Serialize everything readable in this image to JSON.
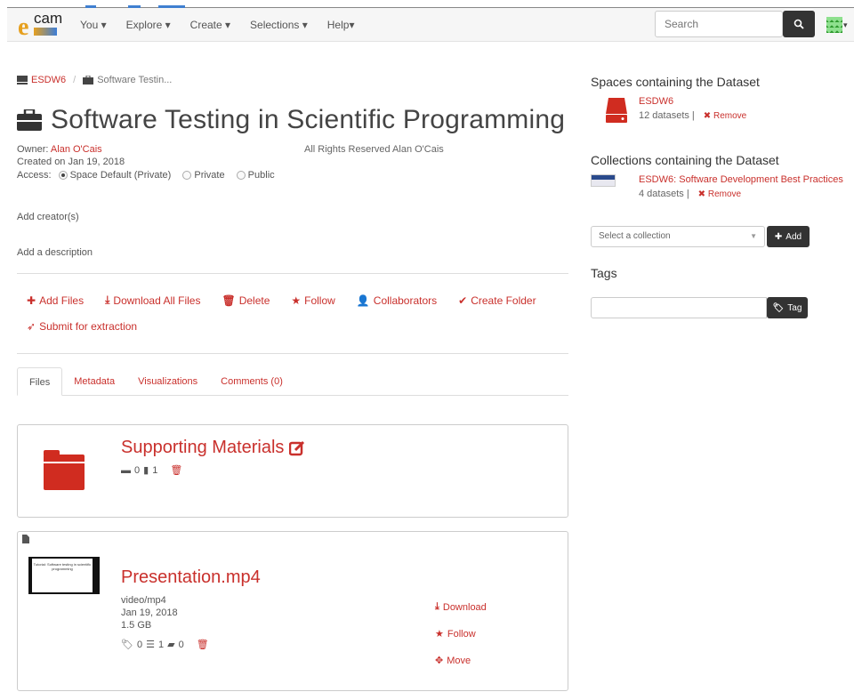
{
  "nav": {
    "menu": [
      "You ▾",
      "Explore ▾",
      "Create ▾",
      "Selections ▾",
      "Help▾"
    ],
    "search_placeholder": "Search",
    "logo_text": "cam"
  },
  "breadcrumb": {
    "space": "ESDW6",
    "separator": "/",
    "dataset": "Software Testin..."
  },
  "dataset": {
    "title": "Software Testing in Scientific Programming",
    "owner_label": "Owner:",
    "owner": "Alan O'Cais",
    "created": "Created on Jan 19, 2018",
    "access_label": "Access:",
    "access_options": [
      "Space Default (Private)",
      "Private",
      "Public"
    ],
    "rights": "All Rights Reserved Alan O'Cais",
    "add_creator": "Add creator(s)",
    "add_description": "Add a description"
  },
  "actions": {
    "add_files": "Add Files",
    "download_all": "Download All Files",
    "delete": "Delete",
    "follow": "Follow",
    "collaborators": "Collaborators",
    "create_folder": "Create Folder",
    "submit_extraction": "Submit for extraction"
  },
  "tabs": [
    "Files",
    "Metadata",
    "Visualizations",
    "Comments (0)"
  ],
  "folder": {
    "name": "Supporting Materials",
    "folders": "0",
    "files": "1"
  },
  "file": {
    "name": "Presentation.mp4",
    "type": "video/mp4",
    "date": "Jan 19, 2018",
    "size": "1.5 GB",
    "tags": "0",
    "metadata": "1",
    "comments": "0",
    "download": "Download",
    "follow": "Follow",
    "move": "Move",
    "thumb_text": "Tutorial: Software testing in scientific programming"
  },
  "sidebar": {
    "spaces_heading": "Spaces containing the Dataset",
    "space_name": "ESDW6",
    "space_count": "12 datasets |",
    "collections_heading": "Collections containing the Dataset",
    "collection_name": "ESDW6: Software Development Best Practices",
    "collection_count": "4 datasets |",
    "remove": "Remove",
    "select_placeholder": "Select a collection",
    "add_button": "Add",
    "tags_heading": "Tags",
    "tag_button": "Tag"
  },
  "colors": {
    "accent": "#c9302c",
    "dark_button": "#333333"
  }
}
